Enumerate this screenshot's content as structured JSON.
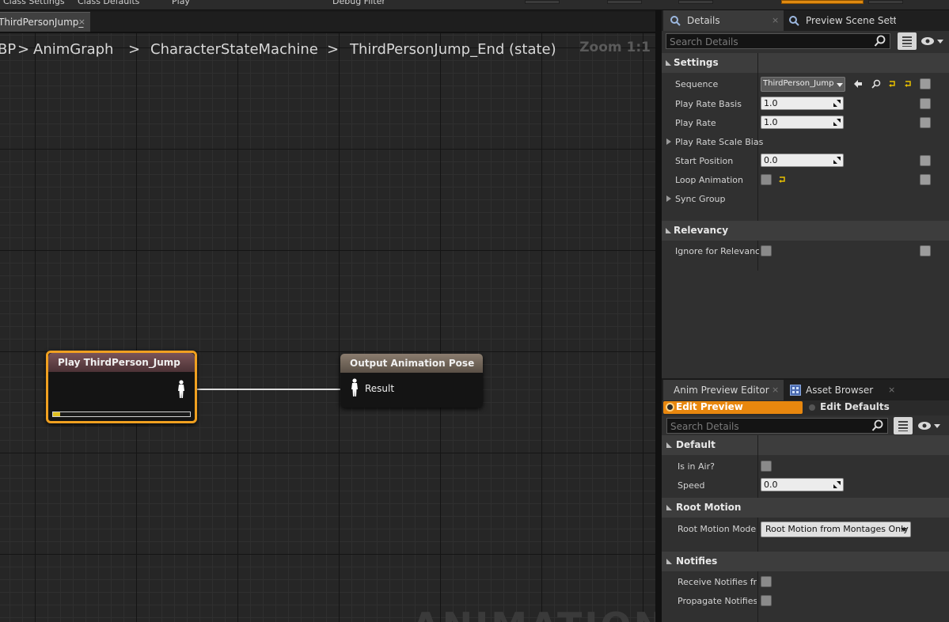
{
  "toolbar": {
    "class_settings": "Class Settings",
    "class_defaults": "Class Defaults",
    "play": "Play",
    "debug_filter": "Debug Filter"
  },
  "graph_tab": {
    "label": "ThirdPersonJump_",
    "close": "×"
  },
  "breadcrumb": {
    "items": [
      "BP",
      "AnimGraph",
      "CharacterStateMachine",
      "ThirdPersonJump_End (state)"
    ],
    "separator": ">"
  },
  "zoom": "Zoom 1:1",
  "watermark": "ANIMATION",
  "nodes": {
    "play": {
      "title": "Play ThirdPerson_Jump",
      "progress": 0.05
    },
    "output": {
      "title": "Output Animation Pose",
      "pin_label": "Result"
    }
  },
  "details": {
    "tabs": [
      {
        "label": "Details",
        "close": "×"
      },
      {
        "label": "Preview Scene Sett",
        "close": "×"
      }
    ],
    "search_placeholder": "Search Details",
    "settings": {
      "title": "Settings",
      "sequence_label": "Sequence",
      "sequence_value": "ThirdPerson_Jump",
      "play_rate_basis_label": "Play Rate Basis",
      "play_rate_basis_value": "1.0",
      "play_rate_label": "Play Rate",
      "play_rate_value": "1.0",
      "play_rate_scale_bias_label": "Play Rate Scale Bias",
      "start_position_label": "Start Position",
      "start_position_value": "0.0",
      "loop_animation_label": "Loop Animation",
      "sync_group_label": "Sync Group"
    },
    "relevancy": {
      "title": "Relevancy",
      "ignore_label": "Ignore for Relevancy"
    }
  },
  "preview": {
    "tabs": [
      {
        "label": "Anim Preview Editor",
        "close": "×"
      },
      {
        "label": "Asset Browser",
        "close": "×"
      }
    ],
    "edit_preview": "Edit Preview",
    "edit_defaults": "Edit Defaults",
    "search_placeholder": "Search Details",
    "default": {
      "title": "Default",
      "is_in_air_label": "Is in Air?",
      "speed_label": "Speed",
      "speed_value": "0.0"
    },
    "root_motion": {
      "title": "Root Motion",
      "mode_label": "Root Motion Mode",
      "mode_value": "Root Motion from Montages Only"
    },
    "notifies": {
      "title": "Notifies",
      "receive_label": "Receive Notifies fro",
      "propagate_label": "Propagate Notifies t"
    }
  },
  "colors": {
    "selection_orange": "#f0a020",
    "edit_preview_orange": "#e8870e",
    "graph_bg": "#262626",
    "panel_bg": "#303030"
  }
}
